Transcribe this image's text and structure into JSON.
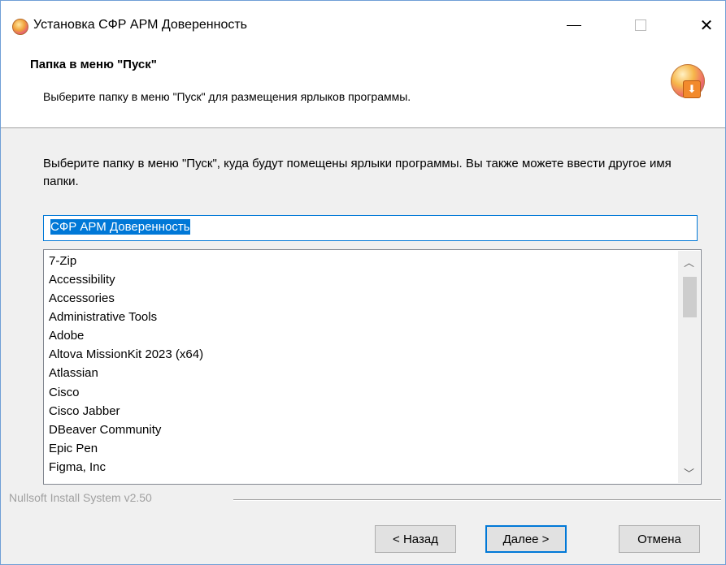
{
  "window": {
    "title": "Установка СФР АРМ Доверенность",
    "controls": {
      "minimize": "—",
      "maximize": "",
      "close": "✕"
    }
  },
  "header": {
    "title": "Папка в меню \"Пуск\"",
    "subtitle": "Выберите папку в меню \"Пуск\" для размещения ярлыков программы."
  },
  "main": {
    "description": "Выберите папку в меню \"Пуск\", куда будут помещены ярлыки программы. Вы также можете ввести другое имя папки.",
    "folder_value": "СФР АРМ Доверенность",
    "folders": [
      "7-Zip",
      "Accessibility",
      "Accessories",
      "Administrative Tools",
      "Adobe",
      "Altova MissionKit 2023 (x64)",
      "Atlassian",
      "Cisco",
      "Cisco Jabber",
      "DBeaver Community",
      "Epic Pen",
      "Figma, Inc"
    ]
  },
  "footer": {
    "branding": "Nullsoft Install System v2.50",
    "back_label": "< Назад",
    "next_label": "Далее >",
    "cancel_label": "Отмена"
  }
}
